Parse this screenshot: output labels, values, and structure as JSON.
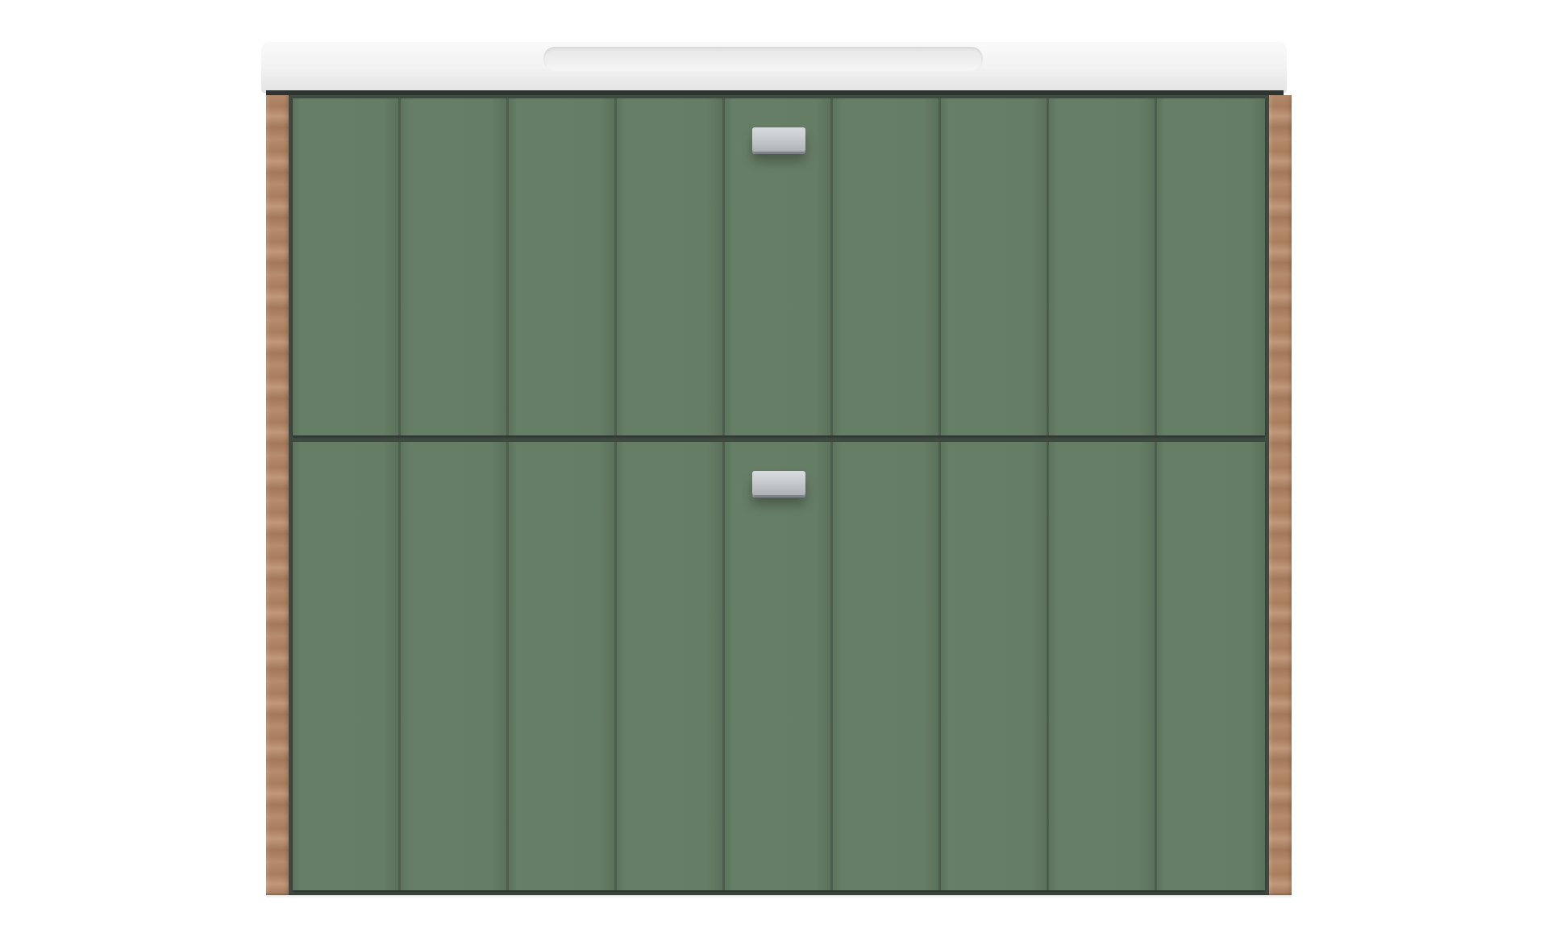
{
  "product": {
    "drawers": [
      {
        "id": "top",
        "panel_count": 9,
        "handle_panel": 5
      },
      {
        "id": "bottom",
        "panel_count": 9,
        "handle_panel": 5
      }
    ],
    "colors": {
      "front": "#647a63",
      "groove": "#4c5e4b",
      "countertop": "#f3f3f3",
      "wood_side": "#b58a6a",
      "handle": "#c3c7cb",
      "background": "#ffffff"
    },
    "icons": [
      "drawer-handle-icon"
    ]
  }
}
